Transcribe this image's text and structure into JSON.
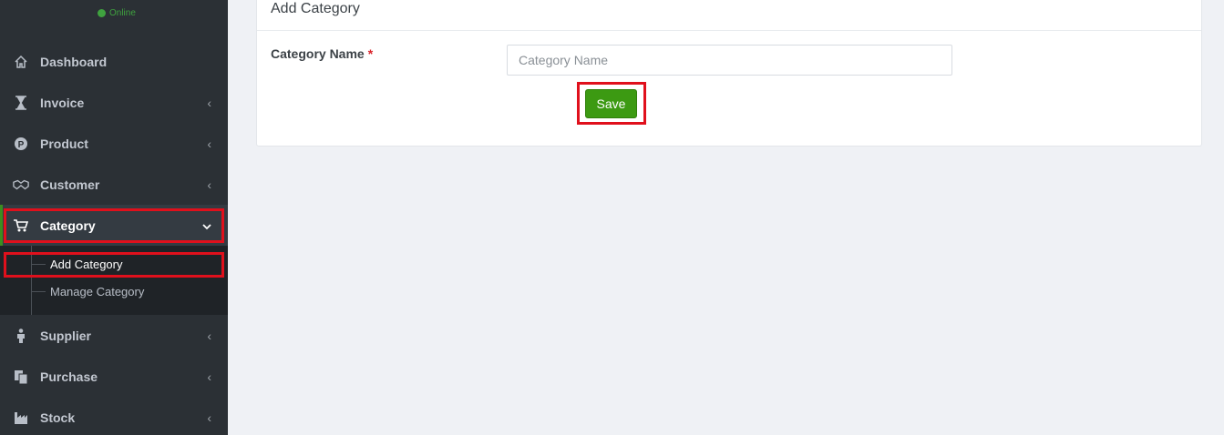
{
  "sidebar": {
    "status": "Online",
    "items": [
      {
        "label": "Dashboard",
        "icon": "home-icon",
        "chevron": ""
      },
      {
        "label": "Invoice",
        "icon": "hourglass-icon",
        "chevron": "‹"
      },
      {
        "label": "Product",
        "icon": "product-p-icon",
        "chevron": "‹"
      },
      {
        "label": "Customer",
        "icon": "handshake-icon",
        "chevron": "‹"
      },
      {
        "label": "Category",
        "icon": "cart-icon",
        "chevron": "⌄"
      },
      {
        "label": "Supplier",
        "icon": "person-icon",
        "chevron": "‹"
      },
      {
        "label": "Purchase",
        "icon": "copy-icon",
        "chevron": "‹"
      },
      {
        "label": "Stock",
        "icon": "industry-icon",
        "chevron": "‹"
      }
    ],
    "category_submenu": [
      {
        "label": "Add Category"
      },
      {
        "label": "Manage Category"
      }
    ]
  },
  "main": {
    "card_title": "Add Category",
    "field_label": "Category Name",
    "required_mark": "*",
    "input_placeholder": "Category Name",
    "input_value": "",
    "save_label": "Save"
  },
  "colors": {
    "sidebar_bg": "#2b3035",
    "accent_green": "#3c9a12",
    "highlight_red": "#e0101c",
    "page_bg": "#eff1f5"
  }
}
